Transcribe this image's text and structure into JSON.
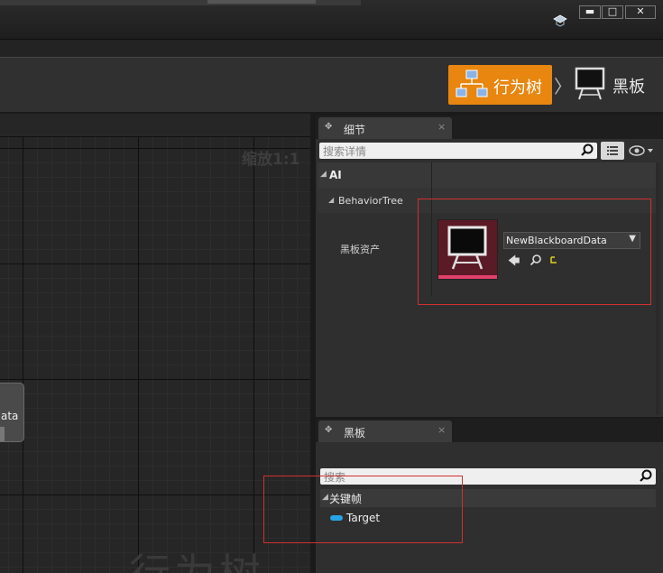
{
  "window": {
    "minimize": "▬",
    "maximize": "□",
    "close": "✕"
  },
  "modes": {
    "behavior_tree": "行为树",
    "separator": "〉",
    "blackboard": "黑板"
  },
  "graph": {
    "zoom_label": "缩放1:1",
    "node_label": "ata",
    "watermark": "行为树"
  },
  "details": {
    "tab_label": "细节",
    "tab_close": "×",
    "search_placeholder": "搜索详情",
    "category_ai": "AI",
    "category_behavior_tree": "BehaviorTree",
    "property_label": "黑板资产",
    "asset_value": "NewBlackboardData"
  },
  "blackboard": {
    "tab_label": "黑板",
    "tab_close": "×",
    "search_placeholder": "搜索",
    "category": "关键帧",
    "keys": [
      "Target"
    ]
  },
  "colors": {
    "accent_orange": "#e8860f",
    "key_blue": "#25a4e6",
    "highlight_red": "#d23030"
  }
}
